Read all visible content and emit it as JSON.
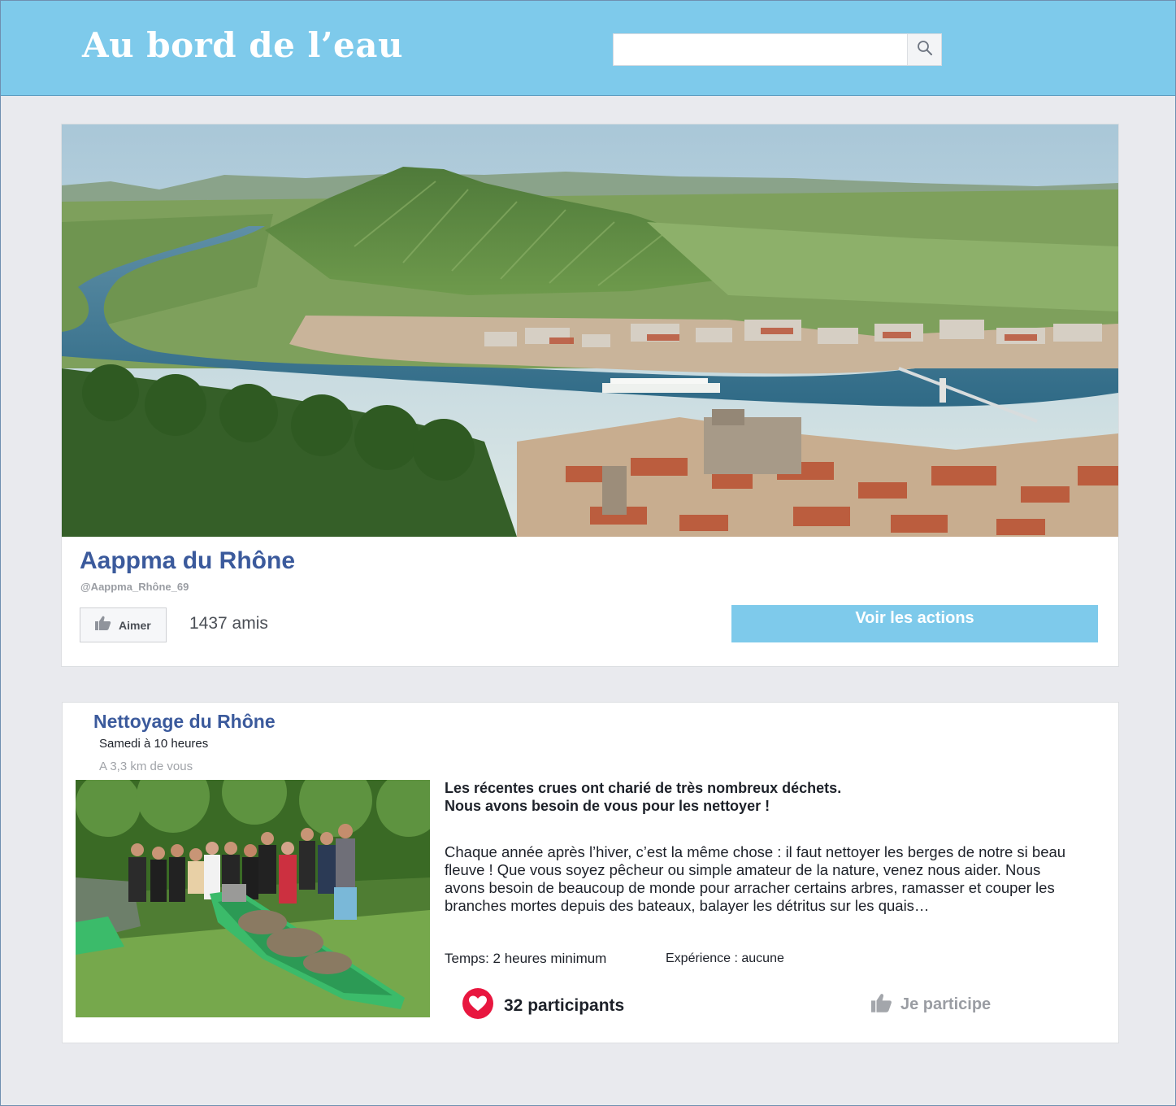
{
  "header": {
    "brand": "Au bord de l’eau",
    "search": {
      "value": "",
      "placeholder": "",
      "icon": "search-icon"
    }
  },
  "page": {
    "name": "Aappma du Rhône",
    "handle": "@Aappma_Rhône_69",
    "like_label": "Aimer",
    "friends": "1437 amis",
    "actions_label": "Voir les actions"
  },
  "event": {
    "title": "Nettoyage du Rhône",
    "date": "Samedi à 10 heures",
    "distance": "A 3,3 km de vous",
    "lead_line1": "Les récentes crues ont charié de très nombreux déchets.",
    "lead_line2": "Nous avons besoin de vous pour les nettoyer !",
    "body": "Chaque année après l’hiver, c’est la même chose : il faut nettoyer les berges de notre si beau fleuve ! Que vous soyez pêcheur ou simple amateur de la nature, venez nous aider. Nous avons besoin de beaucoup de monde pour arracher certains arbres, ramasser et couper les branches mortes depuis des bateaux, balayer les détritus sur les quais…",
    "time": "Temps: 2 heures minimum",
    "experience": "Expérience : aucune",
    "participants": "32 participants",
    "join_label": "Je participe"
  },
  "colors": {
    "topbar": "#7ecaeb",
    "link_blue": "#3b5a9c",
    "heart_red": "#e8173f",
    "muted_gray": "#9a9da3",
    "page_bg": "#e9eaee"
  }
}
